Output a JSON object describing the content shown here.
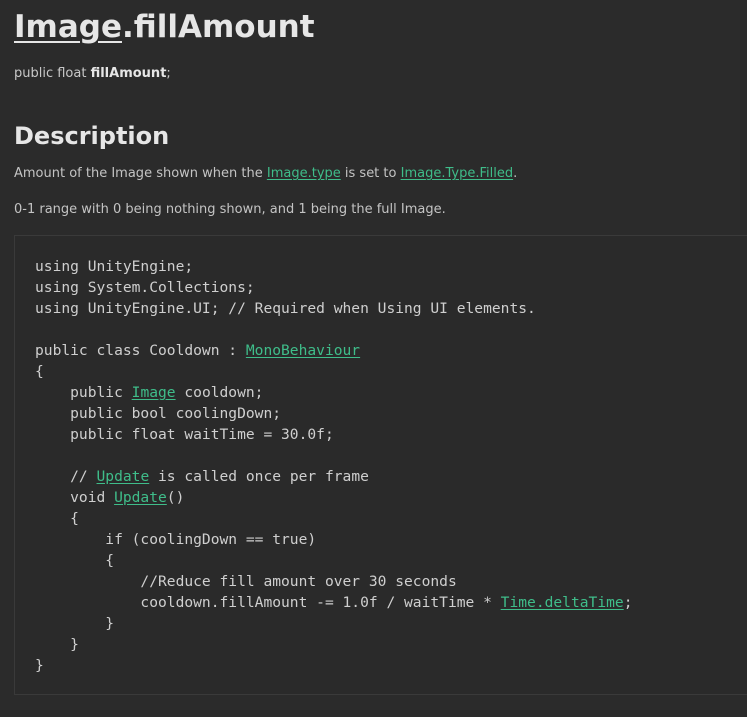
{
  "header": {
    "title_link": "Image",
    "title_rest": ".fillAmount"
  },
  "signature": {
    "prefix": "public float ",
    "name": "fillAmount",
    "suffix": ";"
  },
  "description": {
    "heading": "Description",
    "p1_a": "Amount of the Image shown when the ",
    "p1_link1": "Image.type",
    "p1_b": " is set to ",
    "p1_link2": "Image.Type.Filled",
    "p1_c": ".",
    "p2": "0-1 range with 0 being nothing shown, and 1 being the full Image."
  },
  "code": {
    "l1": "using UnityEngine;",
    "l2": "using System.Collections;",
    "l3": "using UnityEngine.UI; // Required when Using UI elements.",
    "l4": "",
    "l5_a": "public class Cooldown : ",
    "l5_link": "MonoBehaviour",
    "l6": "{",
    "l7_a": "    public ",
    "l7_link": "Image",
    "l7_b": " cooldown;",
    "l8": "    public bool coolingDown;",
    "l9": "    public float waitTime = 30.0f;",
    "l10": "",
    "l11_a": "    // ",
    "l11_link": "Update",
    "l11_b": " is called once per frame",
    "l12_a": "    void ",
    "l12_link": "Update",
    "l12_b": "()",
    "l13": "    {",
    "l14": "        if (coolingDown == true)",
    "l15": "        {",
    "l16": "            //Reduce fill amount over 30 seconds",
    "l17_a": "            cooldown.fillAmount -= 1.0f / waitTime * ",
    "l17_link": "Time.deltaTime",
    "l17_b": ";",
    "l18": "        }",
    "l19": "    }",
    "l20": "}"
  }
}
